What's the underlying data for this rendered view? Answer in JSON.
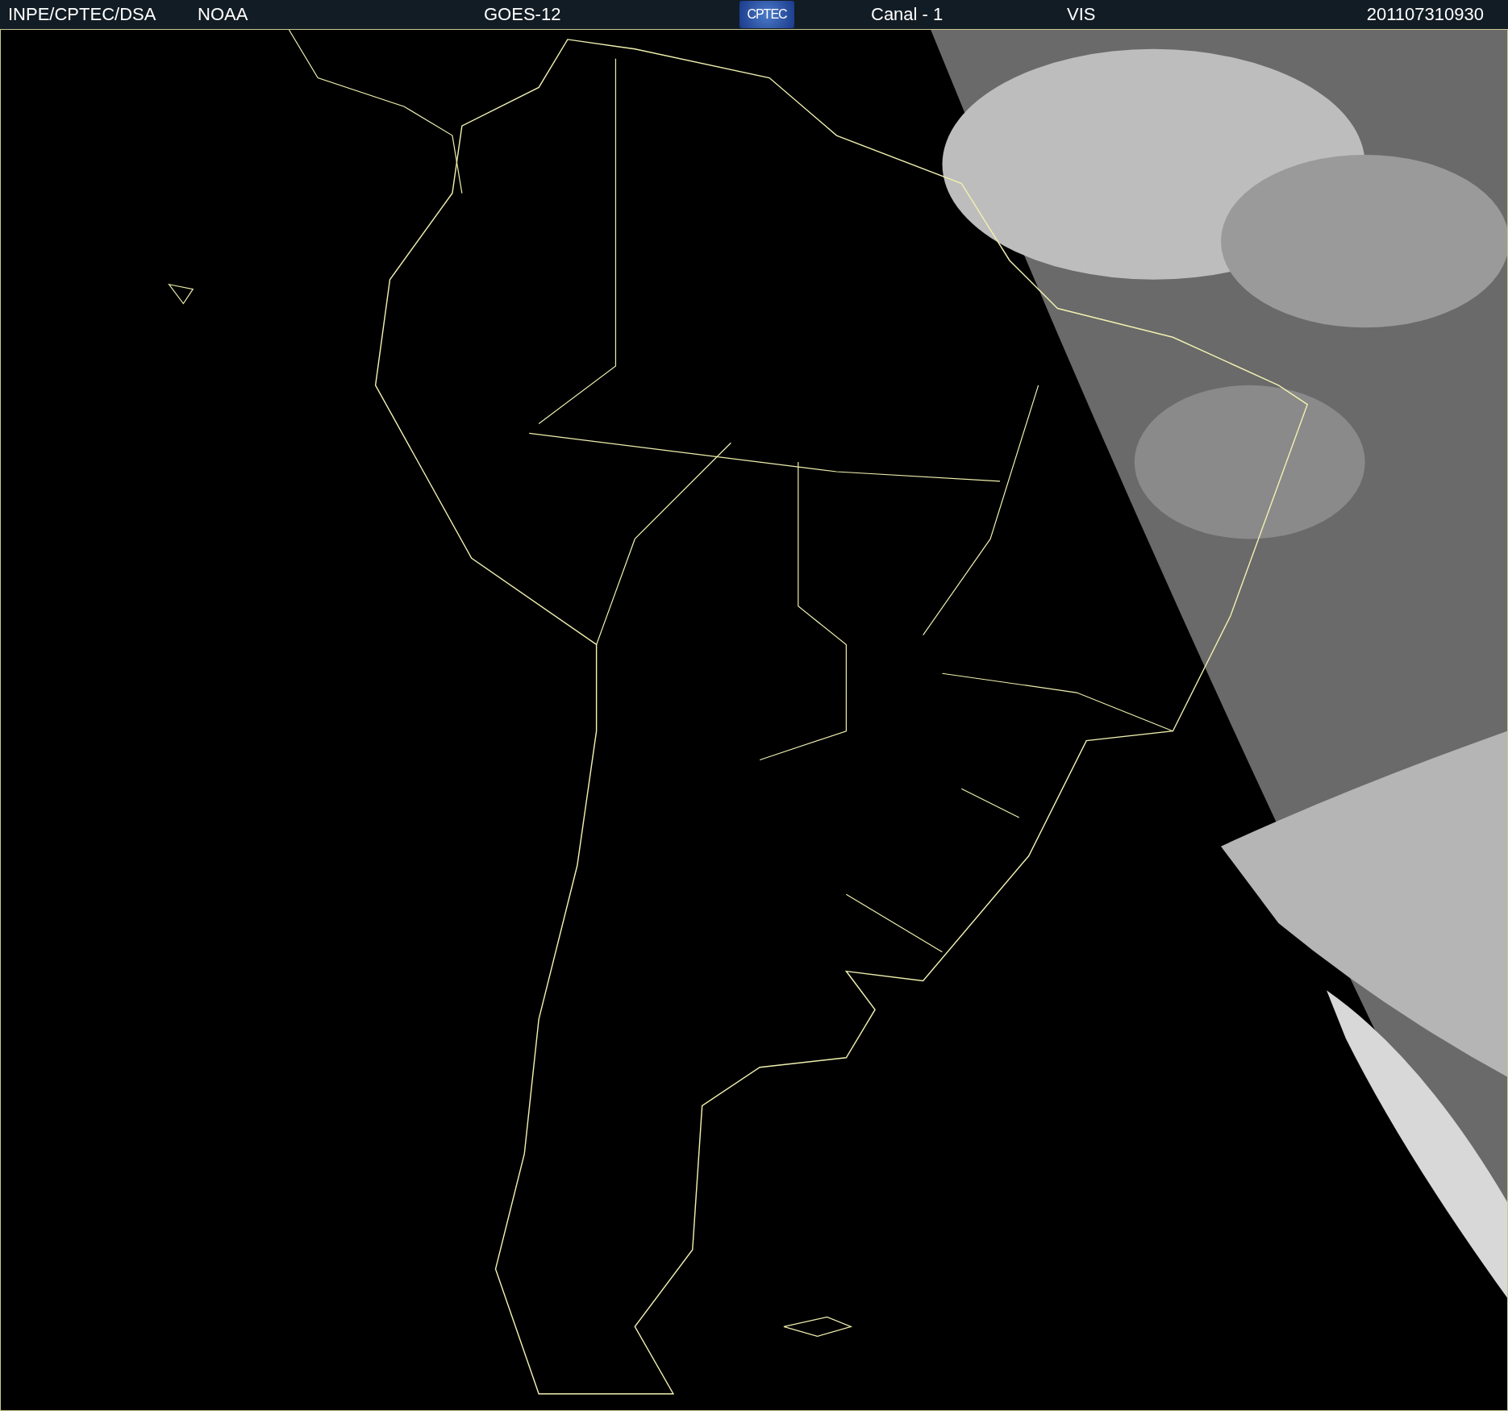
{
  "header": [
    {
      "kind": "text",
      "text": "INPE/CPTEC/DSA"
    },
    {
      "kind": "text",
      "text": "NOAA"
    },
    {
      "kind": "text",
      "text": "GOES-12"
    },
    {
      "kind": "logo",
      "text": "CPTEC"
    },
    {
      "kind": "text",
      "text": "Canal - 1"
    },
    {
      "kind": "text",
      "text": "VIS"
    },
    {
      "kind": "text",
      "text": "201107310930"
    }
  ]
}
